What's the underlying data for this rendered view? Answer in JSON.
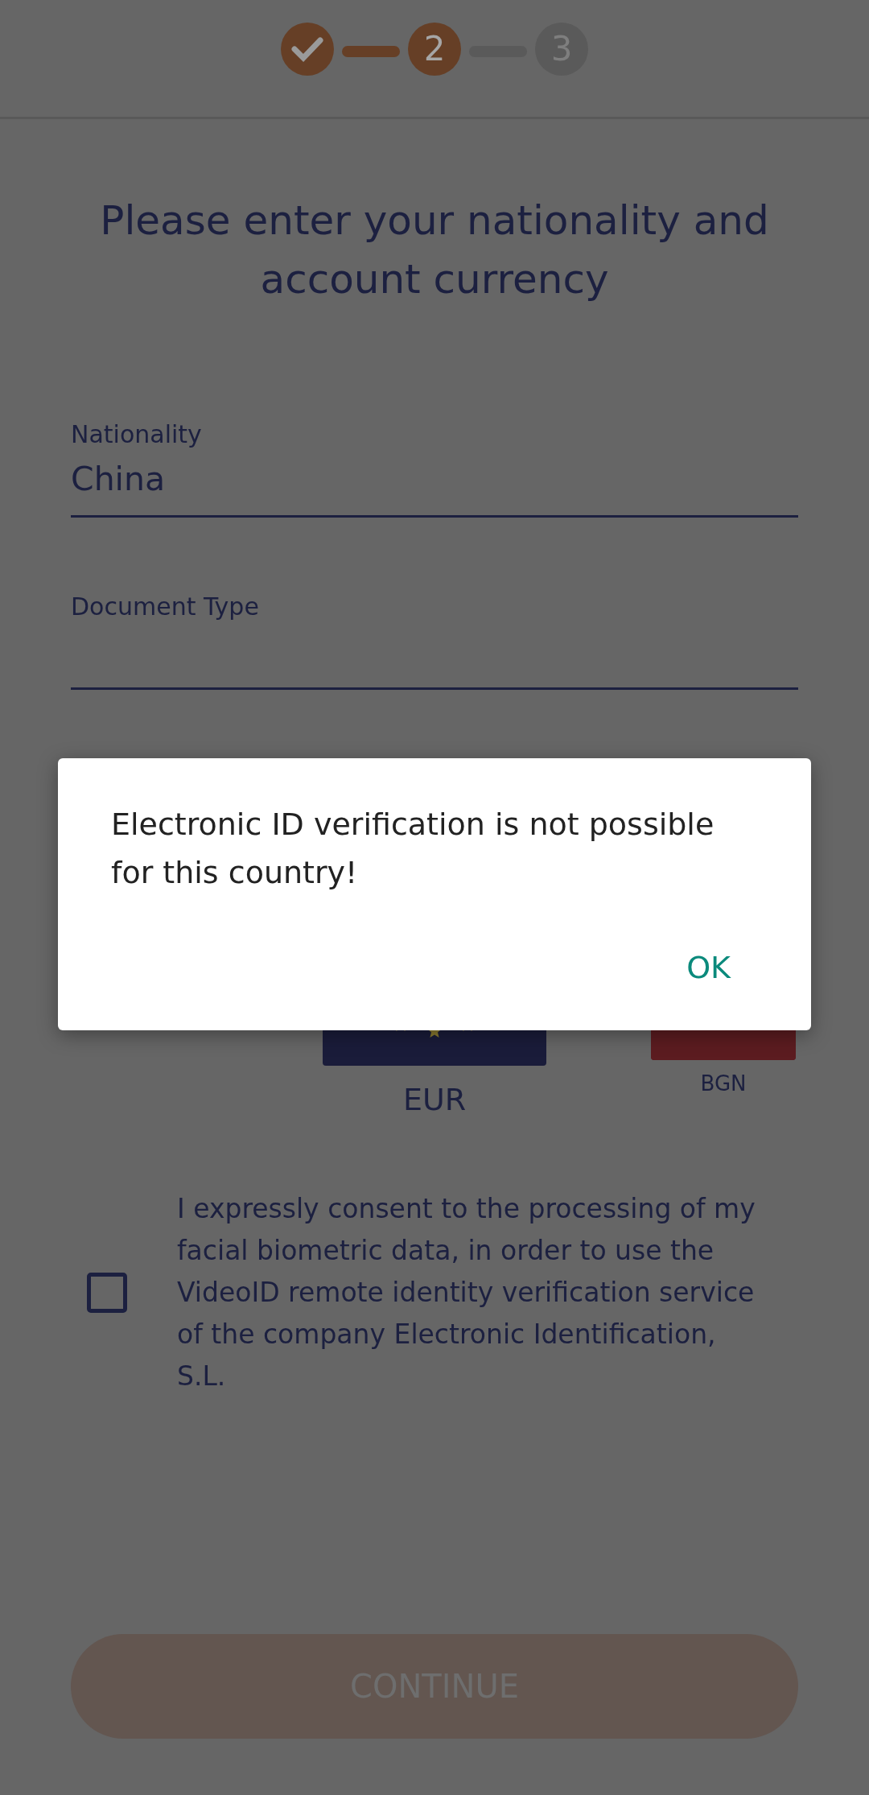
{
  "stepper": {
    "steps": [
      {
        "selected": false
      },
      {
        "label": "2",
        "selected": true
      },
      {
        "label": "3",
        "selected": false
      }
    ]
  },
  "title": "Please enter your nationality and account currency",
  "fields": [
    {
      "label": "Nationality",
      "value": "China"
    },
    {
      "label": "Document Type"
    }
  ],
  "currencies": [
    {
      "code": "EUR",
      "kind": "eu",
      "selected": true
    },
    {
      "code": "BGN",
      "kind": "bg",
      "selected": false
    }
  ],
  "consent": {
    "text": "I expressly consent to the processing of my facial biometric data, in order to use the VideoID remote identity verification service of the company Electronic Identification, S.L.",
    "checked": false
  },
  "continue_button": {
    "label": "CONTINUE",
    "disabled": true
  },
  "dialog": {
    "message": "Electronic ID verification is not possible for this country!",
    "button": "OK"
  }
}
